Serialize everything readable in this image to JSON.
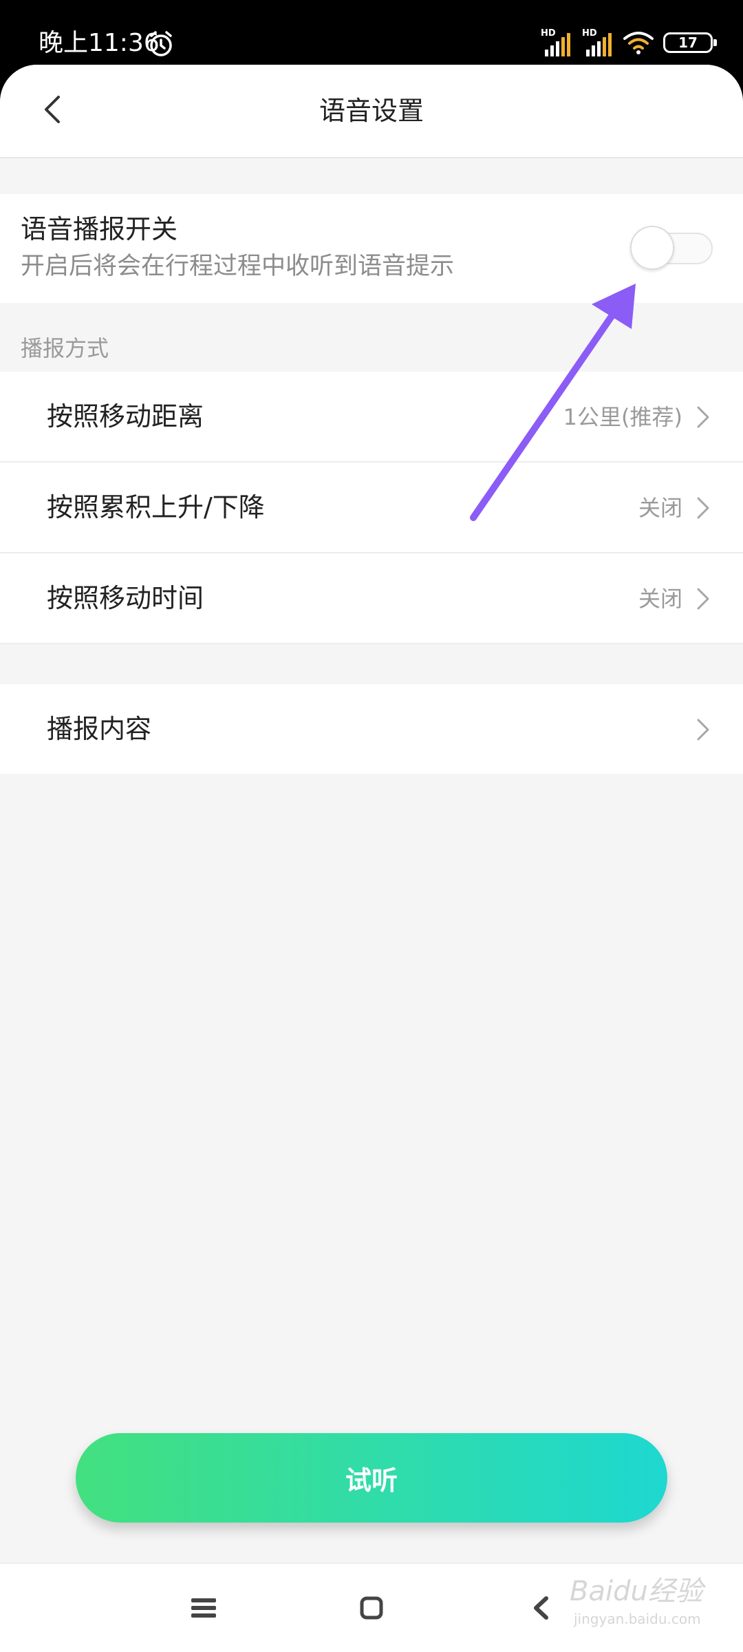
{
  "status_bar": {
    "time": "晚上11:36",
    "signal_label_1": "HD",
    "signal_label_2": "HD",
    "battery_level": "17"
  },
  "header": {
    "title": "语音设置"
  },
  "voice_switch": {
    "title": "语音播报开关",
    "description": "开启后将会在行程过程中收听到语音提示",
    "enabled": false
  },
  "broadcast_mode": {
    "section_label": "播报方式",
    "items": [
      {
        "label": "按照移动距离",
        "value": "1公里(推荐)"
      },
      {
        "label": "按照累积上升/下降",
        "value": "关闭"
      },
      {
        "label": "按照移动时间",
        "value": "关闭"
      }
    ]
  },
  "broadcast_content": {
    "label": "播报内容"
  },
  "cta": {
    "label": "试听"
  },
  "watermark": {
    "text": "Baidu经验",
    "sub": "jingyan.baidu.com"
  },
  "colors": {
    "gradient_start": "#43e07f",
    "gradient_end": "#1ed8d0",
    "arrow": "#8b5cf6",
    "background": "#f5f5f5"
  },
  "icons": {
    "back": "chevron-left-icon",
    "alarm": "alarm-clock-icon",
    "wifi": "wifi-icon",
    "battery": "battery-icon",
    "chevron": "chevron-right-icon",
    "nav_menu": "menu-icon",
    "nav_home": "home-square-icon",
    "nav_back": "back-triangle-icon"
  }
}
